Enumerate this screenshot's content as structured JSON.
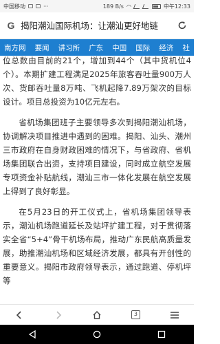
{
  "status_bar": {
    "carrier": "中国移动",
    "network_speed": "189 B/s",
    "time": "中午12:33"
  },
  "search": {
    "query": "揭阳潮汕国际机场：让潮汕更好地链"
  },
  "nav": {
    "tabs": [
      "南方网",
      "要闻",
      "讲习所",
      "广东",
      "中国",
      "国际",
      "经济",
      "社"
    ]
  },
  "article": {
    "paragraphs": [
      "位总数由目前的21个，增加到44个（其中货机位4个）。本期扩建工程满足2025年旅客吞吐量900万人次、货邮吞吐量8万吨、飞机起降7.89万架次的目标设计。项目总投资为10亿元左右。",
      "省机场集团班子主要领导多次到揭阳潮汕机场，协调解决项目推进中遇到的困难。揭阳、汕头、潮州三市政府在自身财政困难的情况下，与省政府、省机场集团联合出资，支持项目建设，同时成立航空发展专项资金补贴航线，潮汕三市一体化发展在航空发展上得到了良好彰显。",
      "在5月23日的开工仪式上，省机场集团领导表示，潮汕机场跑道延长及站坪扩建工程，对于贯彻落实全省“5+4”骨干机场布局，推动广东民航高质量发展，助推潮汕机场和区域经济发展，都具有开创性的重要意义。揭阳市政府领导表示，通过跑道、停机坪等"
    ]
  },
  "bottom_nav": {
    "tab_count": "3"
  },
  "colors": {
    "nav_bg": "#1e7fd0",
    "system_nav_bg": "#000000"
  }
}
